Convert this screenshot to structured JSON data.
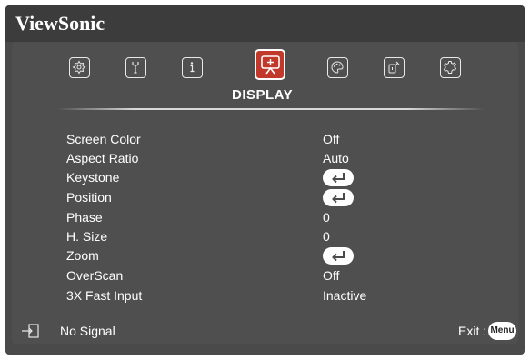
{
  "brand": "ViewSonic",
  "active_tab_label": "DISPLAY",
  "tab_icons": [
    "menu-icon",
    "wrench-icon",
    "info-icon",
    "display-icon",
    "palette-icon",
    "power-settings-icon",
    "gear-icon"
  ],
  "accent_color": "#c0392b",
  "menu": [
    {
      "label": "Screen Color",
      "value": "Off"
    },
    {
      "label": "Aspect Ratio",
      "value": "Auto"
    },
    {
      "label": "Keystone",
      "value": "enter"
    },
    {
      "label": "Position",
      "value": "enter"
    },
    {
      "label": "Phase",
      "value": "0"
    },
    {
      "label": "H. Size",
      "value": "0"
    },
    {
      "label": "Zoom",
      "value": "enter"
    },
    {
      "label": "OverScan",
      "value": "Off"
    },
    {
      "label": "3X Fast Input",
      "value": "Inactive"
    }
  ],
  "footer": {
    "signal_text": "No Signal",
    "exit_text": "Exit :",
    "menu_button_label": "Menu"
  }
}
